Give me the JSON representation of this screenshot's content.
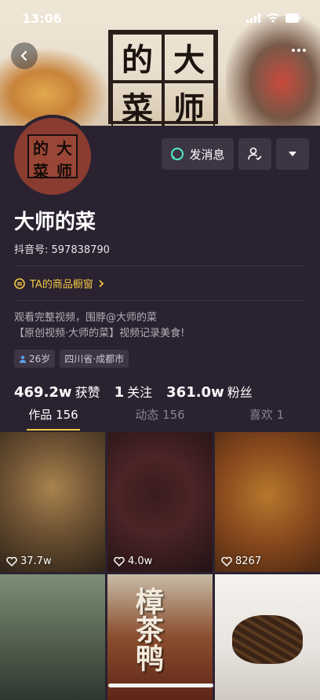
{
  "status_bar": {
    "time": "13:06"
  },
  "banner": {
    "seal_chars": [
      "的",
      "大",
      "菜",
      "师"
    ]
  },
  "avatar": {
    "seal_chars": [
      "的",
      "大",
      "菜",
      "师"
    ]
  },
  "actions": {
    "message_label": "发消息"
  },
  "profile": {
    "name": "大师的菜",
    "douyin_id": "抖音号: 597838790",
    "shop_label": "TA的商品橱窗",
    "bio_line1": "观看完整视频，围脖@大师的菜",
    "bio_line2": "【原创视频·大师的菜】视频记录美食!",
    "tags": {
      "age": "26岁",
      "location": "四川省·成都市"
    }
  },
  "stats": {
    "likes_value": "469.2w",
    "likes_label": "获赞",
    "following_value": "1",
    "following_label": "关注",
    "followers_value": "361.0w",
    "followers_label": "粉丝"
  },
  "tabs": [
    {
      "label": "作品 156"
    },
    {
      "label": "动态 156"
    },
    {
      "label": "喜欢 1"
    }
  ],
  "videos": [
    {
      "likes": "37.7w"
    },
    {
      "likes": "4.0w"
    },
    {
      "likes": "8267"
    },
    {
      "likes": ""
    },
    {
      "overlay_text": "樟茶鸭",
      "likes": ""
    },
    {
      "likes": ""
    }
  ],
  "colors": {
    "accent": "#f2c744",
    "background": "#2a2230",
    "button_bg": "#3d3544"
  }
}
